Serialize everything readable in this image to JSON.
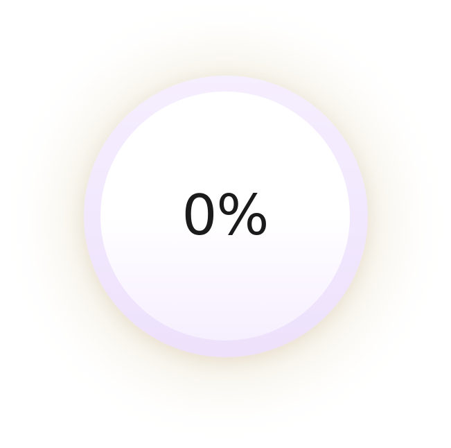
{
  "progress": {
    "value_percent": 0,
    "label": "0%"
  },
  "colors": {
    "ring": "#f3eafe",
    "disc": "#ffffff",
    "text": "#1b1b1b",
    "glow": "#e8dec6"
  }
}
